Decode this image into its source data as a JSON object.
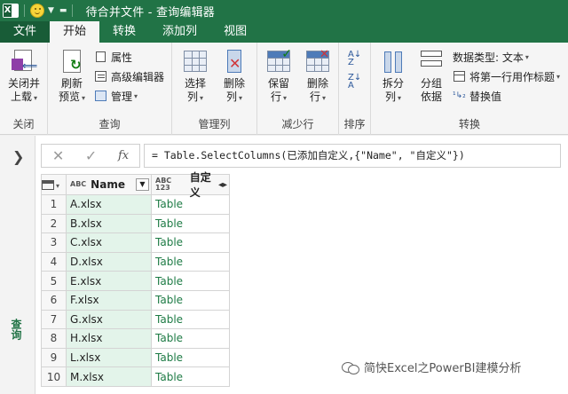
{
  "window": {
    "title": "待合并文件 - 查询编辑器",
    "app_icon": "excel-icon",
    "quick_access": "smiley-icon"
  },
  "tabs": [
    {
      "label": "文件"
    },
    {
      "label": "开始"
    },
    {
      "label": "转换"
    },
    {
      "label": "添加列"
    },
    {
      "label": "视图"
    }
  ],
  "ribbon": {
    "groups": {
      "close": {
        "label": "关闭",
        "btn1": "关闭并",
        "btn2": "上载"
      },
      "query": {
        "label": "查询",
        "refresh1": "刷新",
        "refresh2": "预览",
        "props": "属性",
        "adv": "高级编辑器",
        "manage": "管理"
      },
      "manage_cols": {
        "label": "管理列",
        "select1": "选择",
        "select2": "列",
        "remove1": "删除",
        "remove2": "列"
      },
      "reduce_rows": {
        "label": "减少行",
        "keep1": "保留",
        "keep2": "行",
        "removerows1": "删除",
        "removerows2": "行"
      },
      "sort": {
        "label": "排序"
      },
      "transform": {
        "label": "转换",
        "split1": "拆分",
        "split2": "列",
        "group1": "分组",
        "group2": "依据",
        "dtype": "数据类型: 文本",
        "firstrow": "将第一行用作标题",
        "replace": "替换值"
      }
    }
  },
  "nav": {
    "label": "查询"
  },
  "formula": {
    "text": "= Table.SelectColumns(已添加自定义,{\"Name\", \"自定义\"})"
  },
  "table": {
    "col_name": "Name",
    "col_def": "自定义",
    "type_name": "ABC",
    "type_def": "ABC 123",
    "rows": [
      {
        "i": "1",
        "name": "A.xlsx",
        "def": "Table"
      },
      {
        "i": "2",
        "name": "B.xlsx",
        "def": "Table"
      },
      {
        "i": "3",
        "name": "C.xlsx",
        "def": "Table"
      },
      {
        "i": "4",
        "name": "D.xlsx",
        "def": "Table"
      },
      {
        "i": "5",
        "name": "E.xlsx",
        "def": "Table"
      },
      {
        "i": "6",
        "name": "F.xlsx",
        "def": "Table"
      },
      {
        "i": "7",
        "name": "G.xlsx",
        "def": "Table"
      },
      {
        "i": "8",
        "name": "H.xlsx",
        "def": "Table"
      },
      {
        "i": "9",
        "name": "L.xlsx",
        "def": "Table"
      },
      {
        "i": "10",
        "name": "M.xlsx",
        "def": "Table"
      }
    ]
  },
  "watermark": {
    "text": "简快Excel之PowerBI建模分析"
  },
  "colors": {
    "brand": "#217346",
    "link_green": "#1e7b45",
    "selected_col": "#e3f4ea"
  }
}
